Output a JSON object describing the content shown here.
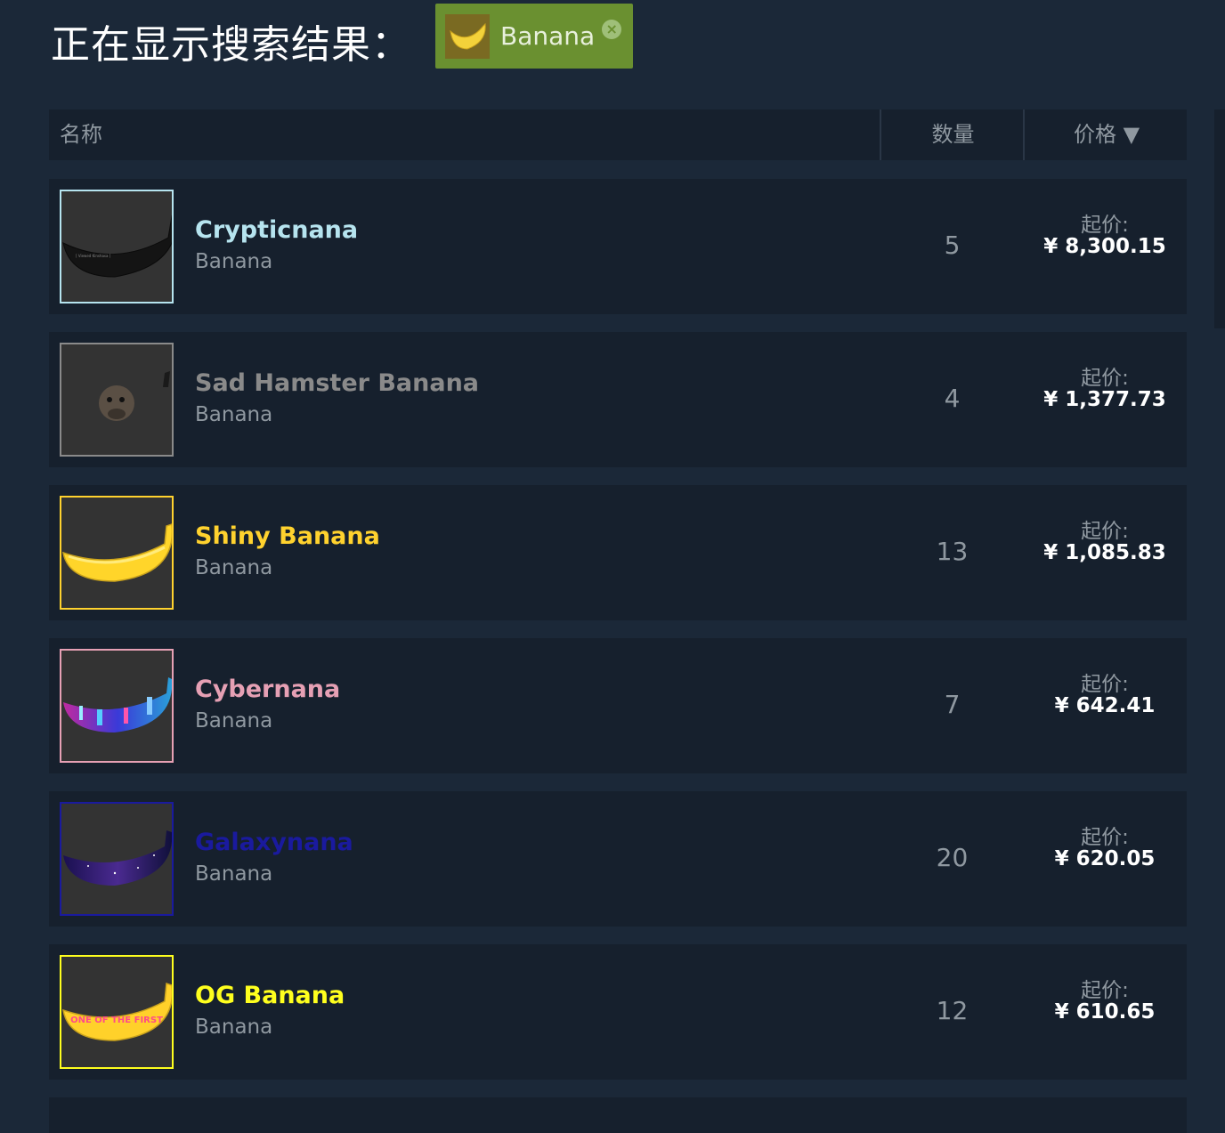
{
  "page": {
    "title": "正在显示搜索结果："
  },
  "filter": {
    "label": "Banana",
    "thumb_icon": "banana-icon",
    "remove_icon": "close-circle-icon"
  },
  "table": {
    "headers": {
      "name": "名称",
      "quantity": "数量",
      "price": "价格 ▼"
    },
    "price_prefix": "起价:",
    "rows": [
      {
        "name": "Crypticnana",
        "game": "Banana",
        "quantity": "5",
        "price": "¥ 8,300.15",
        "name_color": "#b6e4ef",
        "border_color": "#b6e4ef",
        "thumb_icon": "black-banana-icon"
      },
      {
        "name": "Sad Hamster Banana",
        "game": "Banana",
        "quantity": "4",
        "price": "¥ 1,377.73",
        "name_color": "#8a8a8a",
        "border_color": "#8a8a8a",
        "thumb_icon": "hamster-banana-icon"
      },
      {
        "name": "Shiny Banana",
        "game": "Banana",
        "quantity": "13",
        "price": "¥ 1,085.83",
        "name_color": "#ffd22e",
        "border_color": "#ffd22e",
        "thumb_icon": "yellow-banana-icon"
      },
      {
        "name": "Cybernana",
        "game": "Banana",
        "quantity": "7",
        "price": "¥ 642.41",
        "name_color": "#e6a0b4",
        "border_color": "#e6a0b4",
        "thumb_icon": "cyber-banana-icon"
      },
      {
        "name": "Galaxynana",
        "game": "Banana",
        "quantity": "20",
        "price": "¥ 620.05",
        "name_color": "#1a1a9e",
        "border_color": "#1a1a9e",
        "thumb_icon": "galaxy-banana-icon"
      },
      {
        "name": "OG Banana",
        "game": "Banana",
        "quantity": "12",
        "price": "¥ 610.65",
        "name_color": "#ffff1e",
        "border_color": "#ffff1e",
        "thumb_icon": "og-banana-icon",
        "thumb_text": "ONE OF THE FIRST"
      }
    ]
  }
}
